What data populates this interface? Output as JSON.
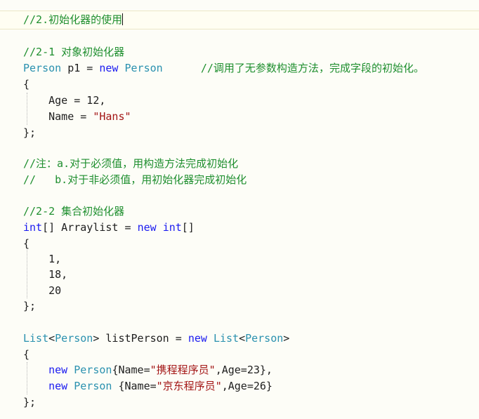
{
  "colors": {
    "comment": "#1f8f2f",
    "type": "#2a91af",
    "keyword": "#1a1af0",
    "string": "#a31515",
    "text": "#1e1e1e",
    "background": "#fdfdf7"
  },
  "code": {
    "l01": [
      "//2.初始化器的使用"
    ],
    "l03": [
      "//2-1 对象初始化器"
    ],
    "l04": [
      "Person",
      " p1 = ",
      "new",
      " ",
      "Person",
      "      ",
      "//调用了无参数构造方法，完成字段的初始化。"
    ],
    "l05": [
      "{"
    ],
    "l06": [
      "    Age = 12,"
    ],
    "l07": [
      "    Name = ",
      "\"Hans\""
    ],
    "l08": [
      "};"
    ],
    "l10": [
      "//注：a.对于必须值，用构造方法完成初始化"
    ],
    "l11": [
      "//   b.对于非必须值，用初始化器完成初始化"
    ],
    "l13": [
      "//2-2 集合初始化器"
    ],
    "l14": [
      "int",
      "[] Arraylist = ",
      "new",
      " ",
      "int",
      "[]"
    ],
    "l15": [
      "{"
    ],
    "l16": [
      "    1,"
    ],
    "l17": [
      "    18,"
    ],
    "l18": [
      "    20"
    ],
    "l19": [
      "};"
    ],
    "l21": [
      "List",
      "<",
      "Person",
      "> listPerson = ",
      "new",
      " ",
      "List",
      "<",
      "Person",
      ">"
    ],
    "l22": [
      "{"
    ],
    "l23": [
      "    ",
      "new",
      " ",
      "Person",
      "{Name=",
      "\"携程程序员\"",
      ",Age=23},"
    ],
    "l24": [
      "    ",
      "new",
      " ",
      "Person",
      " {Name=",
      "\"京东程序员\"",
      ",Age=26}"
    ],
    "l25": [
      "};"
    ]
  }
}
